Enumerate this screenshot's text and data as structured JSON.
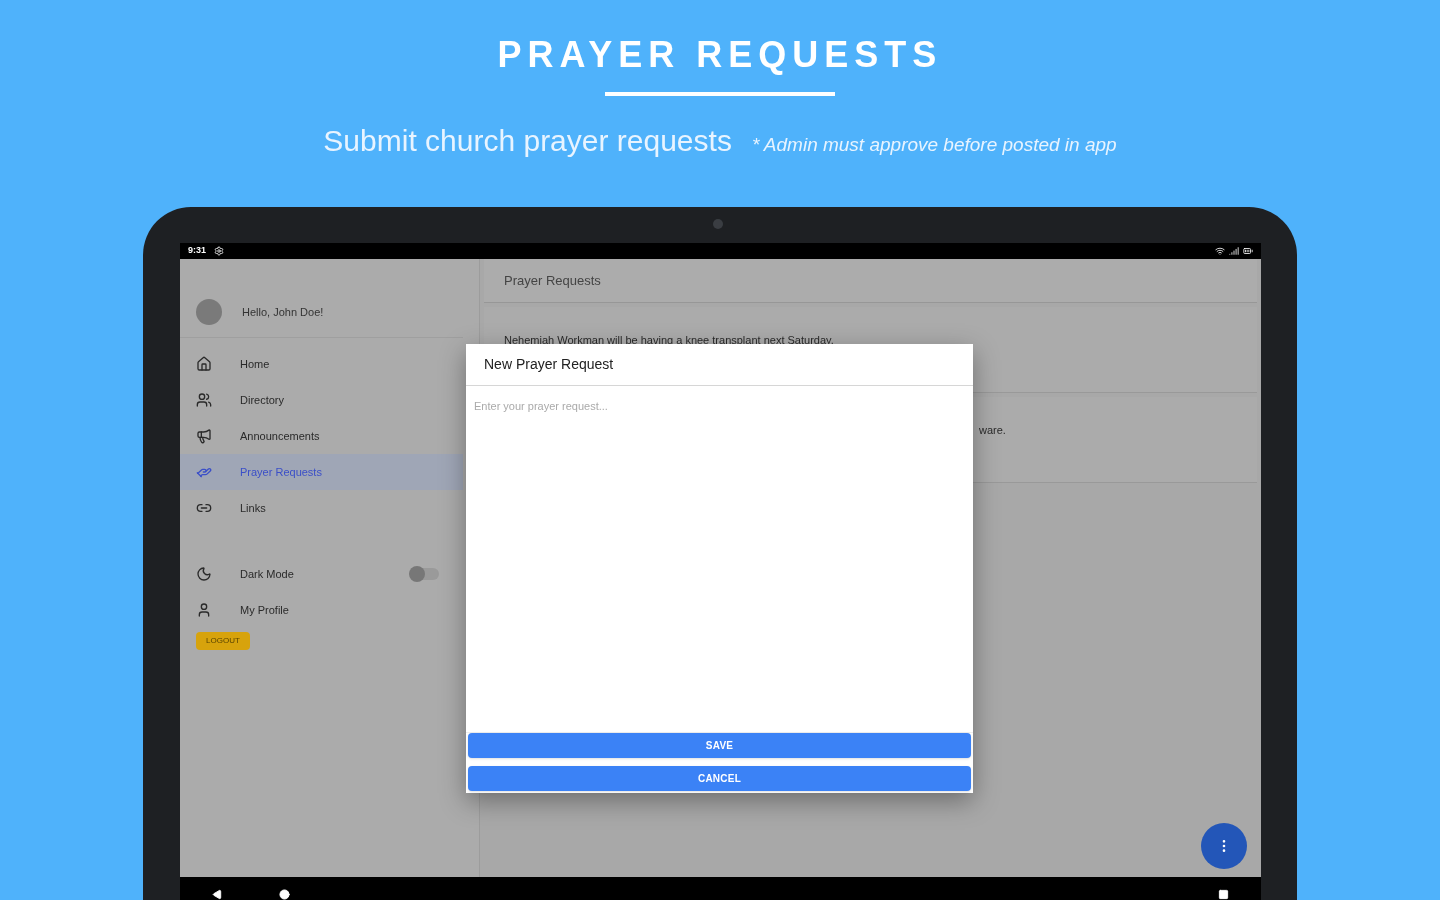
{
  "banner": {
    "title": "PRAYER REQUESTS",
    "subtitle": "Submit church prayer requests",
    "note": "* Admin must approve before posted in app"
  },
  "status_bar": {
    "time": "9:31"
  },
  "sidebar": {
    "greeting": "Hello, John Doe!",
    "items": [
      {
        "label": "Home",
        "selected": false
      },
      {
        "label": "Directory",
        "selected": false
      },
      {
        "label": "Announcements",
        "selected": false
      },
      {
        "label": "Prayer Requests",
        "selected": true
      },
      {
        "label": "Links",
        "selected": false
      }
    ],
    "settings": [
      {
        "label": "Dark Mode",
        "kind": "toggle",
        "on": false
      },
      {
        "label": "My Profile",
        "kind": "link"
      }
    ],
    "logout": "LOGOUT"
  },
  "main": {
    "title": "Prayer Requests",
    "requests": [
      "Nehemiah Workman will be having a knee transplant next Saturday.",
      "ware."
    ]
  },
  "dialog": {
    "title": "New Prayer Request",
    "placeholder": "Enter your prayer request...",
    "buttons": [
      "SAVE",
      "CANCEL"
    ]
  }
}
